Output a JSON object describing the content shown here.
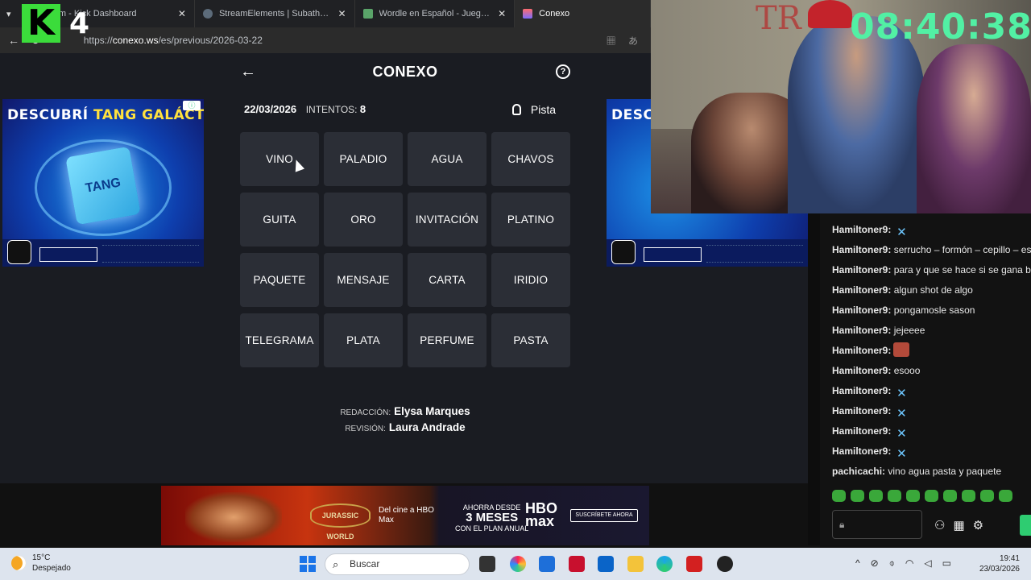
{
  "overlay": {
    "logo_letter": "K",
    "logo_number": "4",
    "clock": "08:40:38"
  },
  "browser": {
    "tabs": [
      {
        "label": "...eam - Kick Dashboard",
        "color": "#53fc18",
        "active": false
      },
      {
        "label": "StreamElements | Subathon Count",
        "color": "#5c6b7a",
        "active": false
      },
      {
        "label": "Wordle en Español - Juego Diario",
        "color": "#5aa469",
        "active": false
      },
      {
        "label": "Conexo",
        "color": "#7b6cff",
        "active": true
      }
    ],
    "url_prefix": "https://",
    "url_host": "conexo.ws",
    "url_path": "/es/previous/2026-03-22"
  },
  "game": {
    "title": "CONEXO",
    "date": "22/03/2026",
    "attempts_label": "INTENTOS:",
    "attempts_value": "8",
    "hint_label": "Pista",
    "words": [
      [
        "VINO",
        "PALADIO",
        "AGUA",
        "CHAVOS"
      ],
      [
        "GUITA",
        "ORO",
        "INVITACIÓN",
        "PLATINO"
      ],
      [
        "PAQUETE",
        "MENSAJE",
        "CARTA",
        "IRIDIO"
      ],
      [
        "TELEGRAMA",
        "PLATA",
        "PERFUME",
        "PASTA"
      ]
    ],
    "credits": [
      {
        "key": "REDACCIÓN:",
        "value": "Elysa Marques"
      },
      {
        "key": "REVISIÓN:",
        "value": "Laura Andrade"
      }
    ]
  },
  "ads": {
    "side_prefix": "DESCUBRÍ",
    "side_highlight": "TANG GALÁCTICO",
    "side_right_head": "DESCU",
    "side_pack": "TANG",
    "bottom_jw": "JURASSIC WORLD",
    "bottom_cine": "Del cine a HBO Max",
    "bottom_offer_top": "AHORRA DESDE",
    "bottom_offer_big": "3 MESES",
    "bottom_offer_bottom": "CON EL PLAN ANUAL",
    "bottom_brand": "HBO max",
    "bottom_cta": "SUSCRÍBETE AHORA"
  },
  "chat": {
    "messages": [
      {
        "user": "Hamiltoner9:",
        "text": "",
        "emote": "butterfly"
      },
      {
        "user": "Hamiltoner9:",
        "text": "serrucho – formón – cepillo – escu",
        "emote": ""
      },
      {
        "user": "Hamiltoner9:",
        "text": "para y que se hace si se gana bro",
        "emote": ""
      },
      {
        "user": "Hamiltoner9:",
        "text": "algun shot de algo",
        "emote": ""
      },
      {
        "user": "Hamiltoner9:",
        "text": "pongamosle sason",
        "emote": ""
      },
      {
        "user": "Hamiltoner9:",
        "text": "jejeeee",
        "emote": ""
      },
      {
        "user": "Hamiltoner9:",
        "text": "",
        "emote": "face"
      },
      {
        "user": "Hamiltoner9:",
        "text": "esooo",
        "emote": ""
      },
      {
        "user": "Hamiltoner9:",
        "text": "",
        "emote": "butterfly"
      },
      {
        "user": "Hamiltoner9:",
        "text": "",
        "emote": "butterfly"
      },
      {
        "user": "Hamiltoner9:",
        "text": "",
        "emote": "butterfly"
      },
      {
        "user": "Hamiltoner9:",
        "text": "",
        "emote": "butterfly"
      },
      {
        "user": "pachicachi:",
        "text": "vino agua pasta y paquete",
        "emote": ""
      }
    ]
  },
  "taskbar": {
    "temp": "15°C",
    "weather": "Despejado",
    "search_placeholder": "Buscar",
    "time": "19:41",
    "date": "23/03/2026"
  }
}
